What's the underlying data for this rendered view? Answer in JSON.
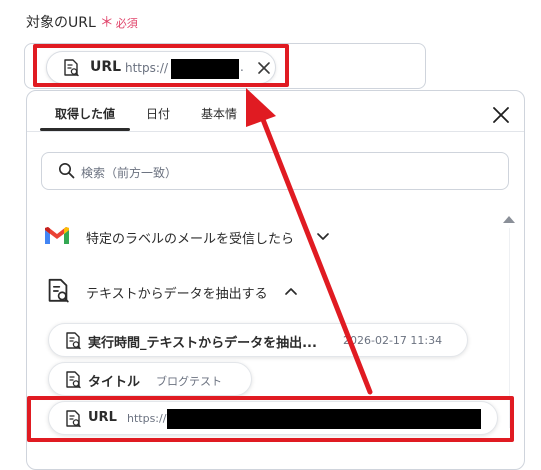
{
  "field": {
    "label": "対象のURL",
    "required_mark": "＊",
    "required_text": "必須",
    "selected_token": {
      "label": "URL",
      "value_prefix": "https://",
      "value_suffix": "."
    }
  },
  "panel": {
    "tabs": [
      {
        "label": "取得した値",
        "active": true
      },
      {
        "label": "日付",
        "active": false
      },
      {
        "label": "基本情",
        "active": false
      }
    ],
    "search_placeholder": "検索（前方一致）",
    "sections": [
      {
        "label": "特定のラベルのメールを受信したら",
        "expanded": false,
        "icon": "gmail-icon"
      },
      {
        "label": "テキストからデータを抽出する",
        "expanded": true,
        "icon": "document-search-icon"
      }
    ],
    "items": [
      {
        "label": "実行時間_テキストからデータを抽出...",
        "value": "2026-02-17 11:34"
      },
      {
        "label": "タイトル",
        "value": "ブログテスト"
      },
      {
        "label": "URL",
        "value": "https://"
      }
    ]
  },
  "colors": {
    "highlight": "#e01b22",
    "required": "#e0436a",
    "gmail_red": "#ea4335",
    "gmail_blue": "#4285f4",
    "gmail_green": "#34a853",
    "gmail_yellow": "#fbbc04"
  }
}
